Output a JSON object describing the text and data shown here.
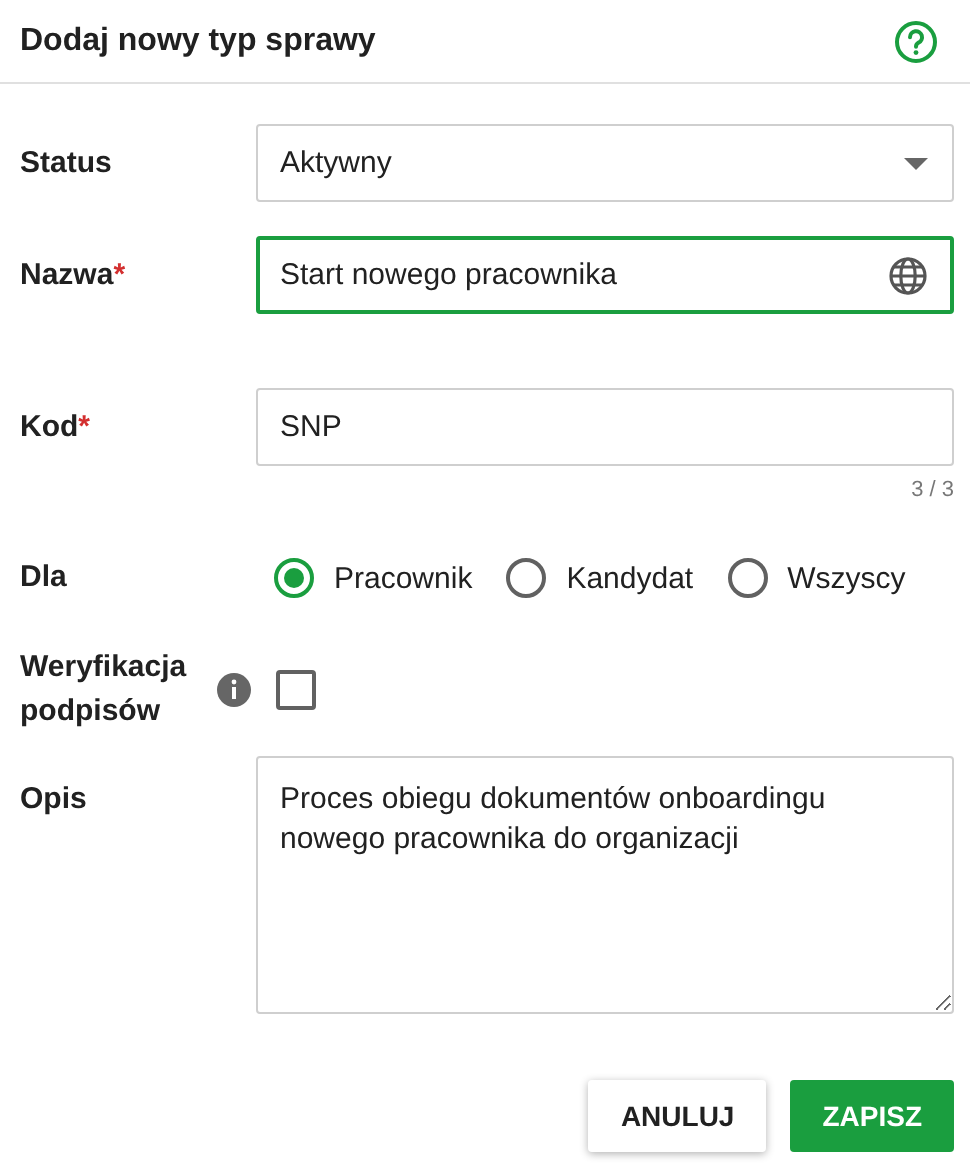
{
  "dialog": {
    "title": "Dodaj nowy typ sprawy"
  },
  "fields": [
    {
      "kind": "select",
      "label": "Status",
      "value": "Aktywny"
    },
    {
      "kind": "text",
      "label": "Nazwa",
      "required_mark": "*",
      "value": "Start nowego pracownika",
      "focused": true,
      "translatable": true
    },
    {
      "kind": "text",
      "label": "Kod",
      "required_mark": "*",
      "value": "SNP",
      "counter": "3 / 3",
      "focused": false,
      "translatable": false
    },
    {
      "kind": "radio",
      "label": "Dla",
      "options": [
        {
          "label": "Pracownik",
          "selected": true
        },
        {
          "label": "Kandydat",
          "selected": false
        },
        {
          "label": "Wszyscy",
          "selected": false
        }
      ]
    },
    {
      "kind": "checkbox",
      "label": "Weryfikacja podpisów",
      "info": true,
      "checked": false
    },
    {
      "kind": "textarea",
      "label": "Opis",
      "value": "Proces obiegu dokumentów onboardingu nowego pracownika do organizacji"
    }
  ],
  "buttons": [
    {
      "label": "ANULUJ",
      "kind": "secondary"
    },
    {
      "label": "ZAPISZ",
      "kind": "primary"
    }
  ]
}
